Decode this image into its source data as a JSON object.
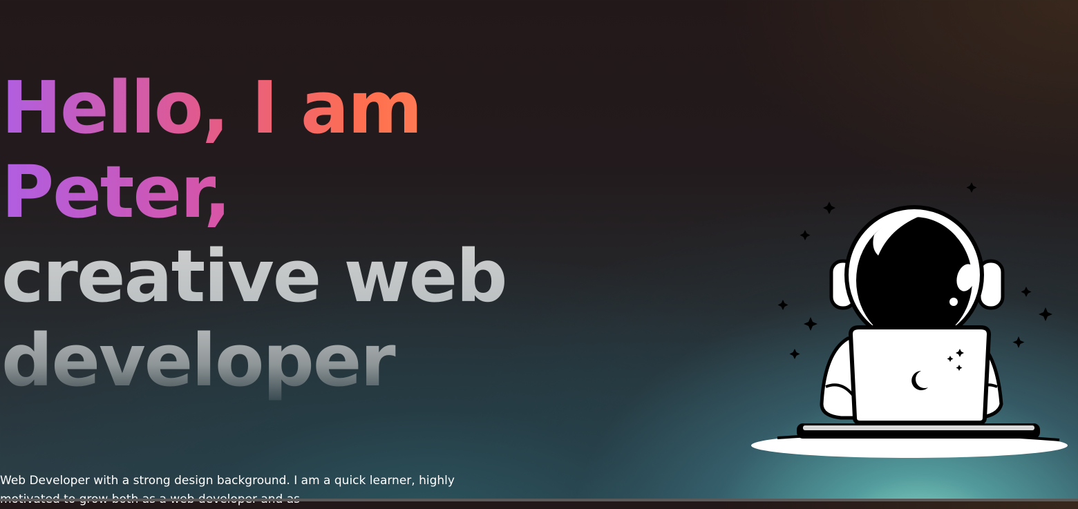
{
  "hero": {
    "headline": {
      "line1": "Hello, I am",
      "line2": "Peter,",
      "line3": "creative web",
      "line4": "developer"
    },
    "intro": "Web Developer with a strong design background. I am a quick learner, highly motivated to grow both as a web developer and as"
  },
  "illustration": {
    "name": "astronaut-with-laptop-illustration"
  },
  "colors": {
    "gradient_start": "#b05ee2",
    "gradient_mid": "#e05a91",
    "gradient_end": "#ff8b5c",
    "accent_glow": "#96ebd2",
    "background": "#231819"
  }
}
